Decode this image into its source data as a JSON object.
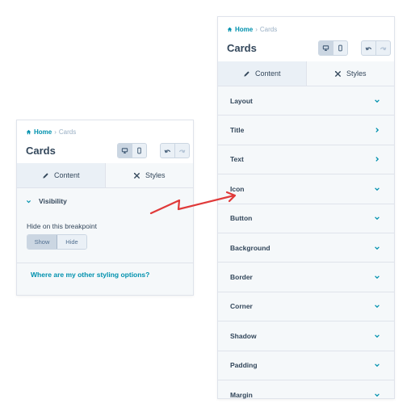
{
  "colors": {
    "accent": "#0091ae",
    "text": "#33475b",
    "annotation": "#e03a3a"
  },
  "left_panel": {
    "breadcrumb": {
      "home": "Home",
      "separator": "›",
      "current": "Cards"
    },
    "title": "Cards",
    "device_buttons": [
      {
        "icon": "desktop-icon",
        "active": true
      },
      {
        "icon": "mobile-icon",
        "active": false
      }
    ],
    "history_buttons": [
      {
        "icon": "undo-icon"
      },
      {
        "icon": "redo-icon"
      }
    ],
    "tabs": [
      {
        "label": "Content",
        "icon": "pencil-icon"
      },
      {
        "label": "Styles",
        "icon": "styles-icon"
      }
    ],
    "visibility": {
      "heading": "Visibility",
      "label": "Hide on this breakpoint",
      "options": [
        {
          "label": "Show",
          "active": true
        },
        {
          "label": "Hide",
          "active": false
        }
      ]
    },
    "help_link": "Where are my other styling options?"
  },
  "right_panel": {
    "breadcrumb": {
      "home": "Home",
      "separator": "›",
      "current": "Cards"
    },
    "title": "Cards",
    "tabs": [
      {
        "label": "Content",
        "icon": "pencil-icon"
      },
      {
        "label": "Styles",
        "icon": "styles-icon"
      }
    ],
    "sections": [
      {
        "label": "Layout",
        "icon": "chevron-down-icon"
      },
      {
        "label": "Title",
        "icon": "chevron-right-icon"
      },
      {
        "label": "Text",
        "icon": "chevron-right-icon"
      },
      {
        "label": "Icon",
        "icon": "chevron-down-icon"
      },
      {
        "label": "Button",
        "icon": "chevron-down-icon"
      },
      {
        "label": "Background",
        "icon": "chevron-down-icon"
      },
      {
        "label": "Border",
        "icon": "chevron-down-icon"
      },
      {
        "label": "Corner",
        "icon": "chevron-down-icon"
      },
      {
        "label": "Shadow",
        "icon": "chevron-down-icon"
      },
      {
        "label": "Padding",
        "icon": "chevron-down-icon"
      },
      {
        "label": "Margin",
        "icon": "chevron-down-icon"
      }
    ]
  }
}
